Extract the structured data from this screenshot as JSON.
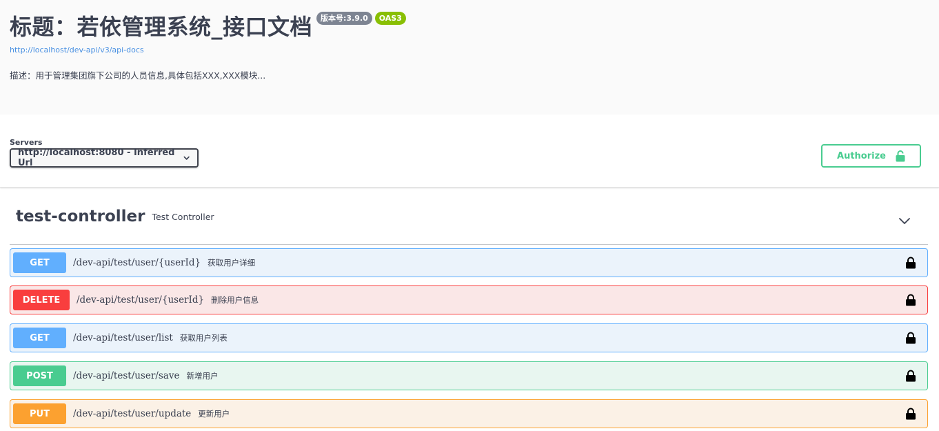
{
  "info": {
    "title": "标题：若依管理系统_接口文档",
    "version_badge": "版本号:3.9.0",
    "oas_badge": "OAS3",
    "url": "http://localhost/dev-api/v3/api-docs",
    "description": "描述：用于管理集团旗下公司的人员信息,具体包括XXX,XXX模块..."
  },
  "servers": {
    "label": "Servers",
    "selected": "http://localhost:8080 - Inferred Url"
  },
  "authorize": {
    "label": "Authorize",
    "icon": "lock-open-icon",
    "color": "#49cc90"
  },
  "tag": {
    "name": "test-controller",
    "description": "Test Controller",
    "toggle_icon": "chevron-down-icon"
  },
  "operations": [
    {
      "method": "GET",
      "path": "/dev-api/test/user/{userId}",
      "summary": "获取用户详细",
      "color": "#61affe"
    },
    {
      "method": "DELETE",
      "path": "/dev-api/test/user/{userId}",
      "summary": "删除用户信息",
      "color": "#f93e3e"
    },
    {
      "method": "GET",
      "path": "/dev-api/test/user/list",
      "summary": "获取用户列表",
      "color": "#61affe"
    },
    {
      "method": "POST",
      "path": "/dev-api/test/user/save",
      "summary": "新增用户",
      "color": "#49cc90"
    },
    {
      "method": "PUT",
      "path": "/dev-api/test/user/update",
      "summary": "更新用户",
      "color": "#fca130"
    }
  ]
}
